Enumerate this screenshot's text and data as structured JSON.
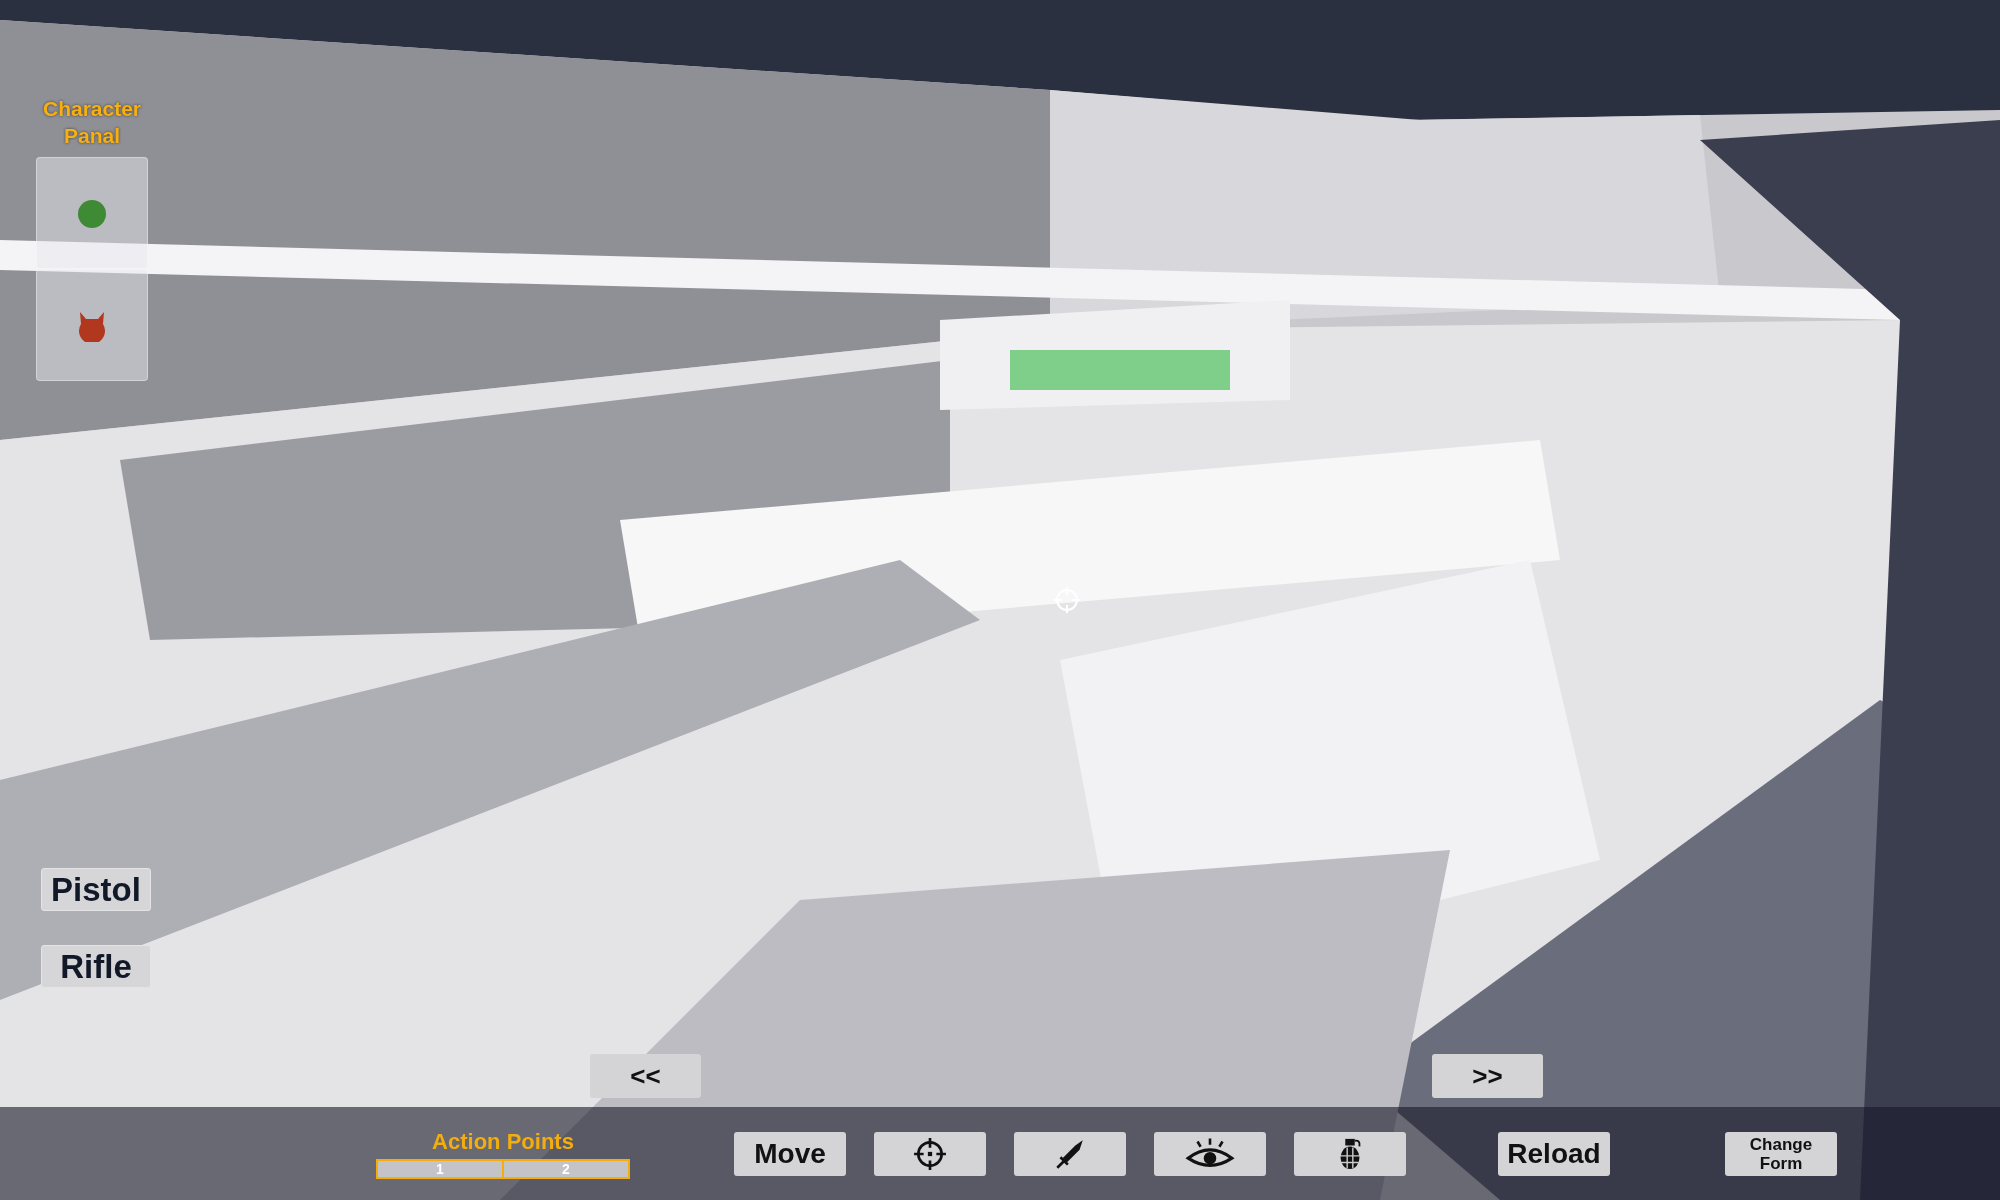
{
  "character_panel": {
    "title": "Character Panal",
    "slots": [
      {
        "kind": "face"
      },
      {
        "kind": "devil"
      }
    ]
  },
  "weapons": [
    "Pistol",
    "Rifle"
  ],
  "nav": {
    "previous": "<<",
    "next": ">>"
  },
  "action_bar": {
    "action_points": {
      "label": "Action Points",
      "segments": [
        "1",
        "2"
      ]
    },
    "actions": [
      {
        "kind": "text",
        "label": "Move"
      },
      {
        "kind": "aim"
      },
      {
        "kind": "melee"
      },
      {
        "kind": "watch"
      },
      {
        "kind": "grenade"
      },
      {
        "kind": "text",
        "label": "Reload"
      },
      {
        "kind": "text",
        "label": "Change Form"
      }
    ]
  }
}
